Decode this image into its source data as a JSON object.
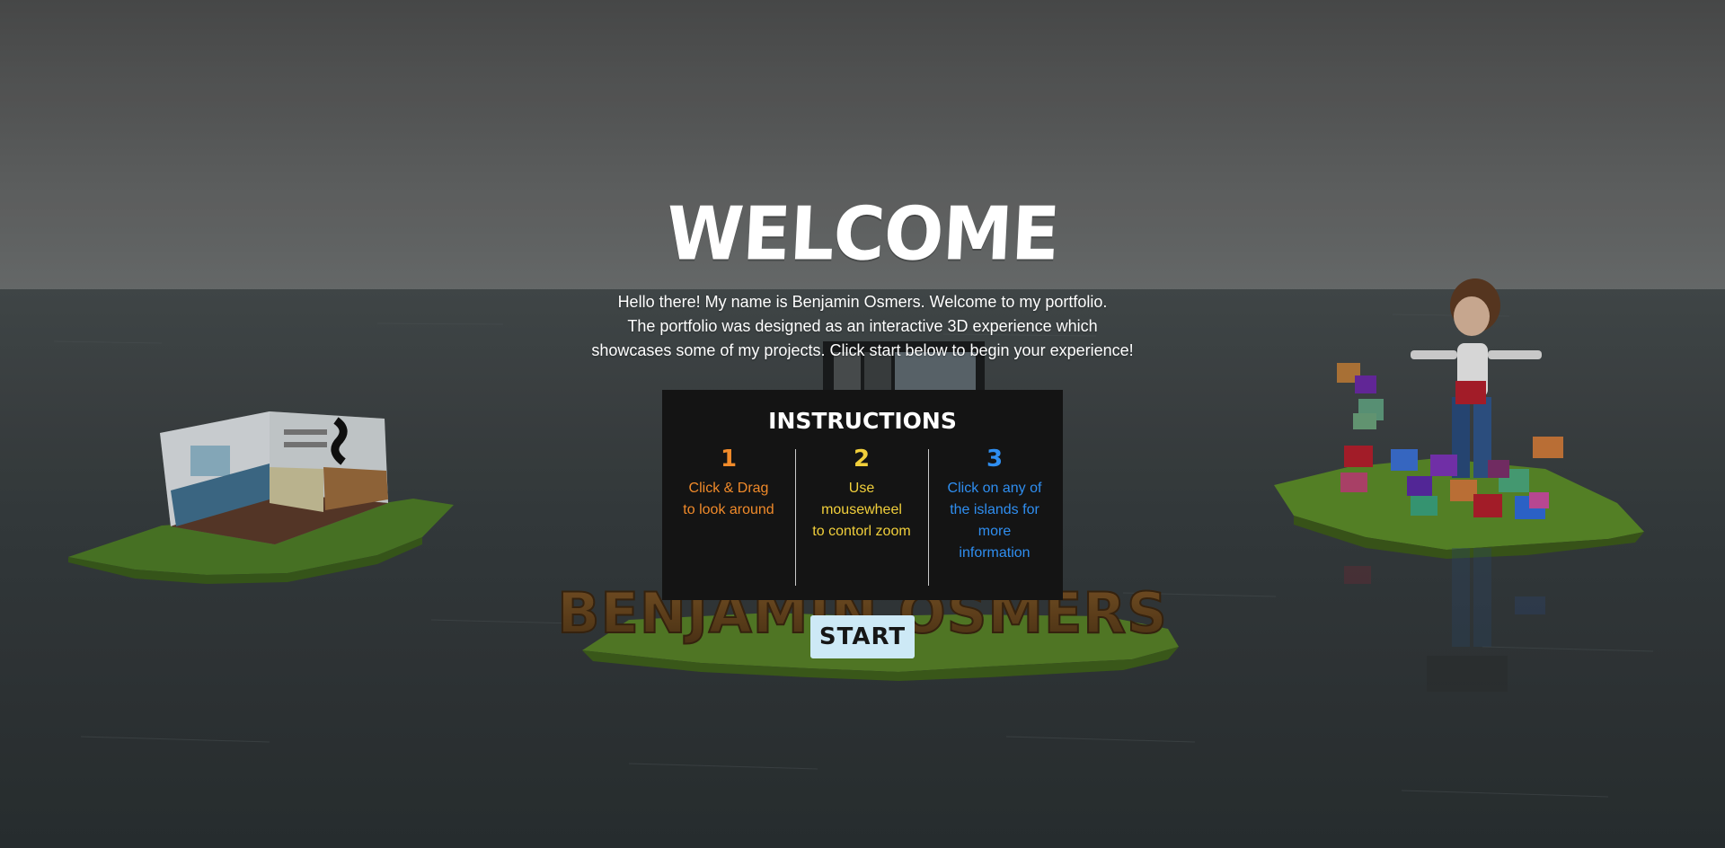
{
  "welcome": {
    "title": "WELCOME",
    "intro_lines": [
      "Hello there! My name is Benjamin Osmers. Welcome to my portfolio.",
      "The portfolio was designed as an interactive 3D experience which",
      "showcases some of my projects. Click start below to begin your experience!"
    ]
  },
  "instructions": {
    "title": "INSTRUCTIONS",
    "steps": [
      {
        "number": "1",
        "lines": [
          "Click & Drag",
          "to look around"
        ],
        "color": "#f08a2a"
      },
      {
        "number": "2",
        "lines": [
          "Use",
          "mousewheel",
          "to contorl zoom"
        ],
        "color": "#f1cf3b"
      },
      {
        "number": "3",
        "lines": [
          "Click on any of",
          "the islands for",
          "more",
          "information"
        ],
        "color": "#2f8ef0"
      }
    ]
  },
  "start_label": "START",
  "scene": {
    "name_sign": "BENJAMIN OSMERS"
  },
  "colors": {
    "panel_bg": "#141414",
    "start_bg": "#cde9f6",
    "sign_text": "#9a6a2e",
    "island_green": "#5c8f2c"
  }
}
